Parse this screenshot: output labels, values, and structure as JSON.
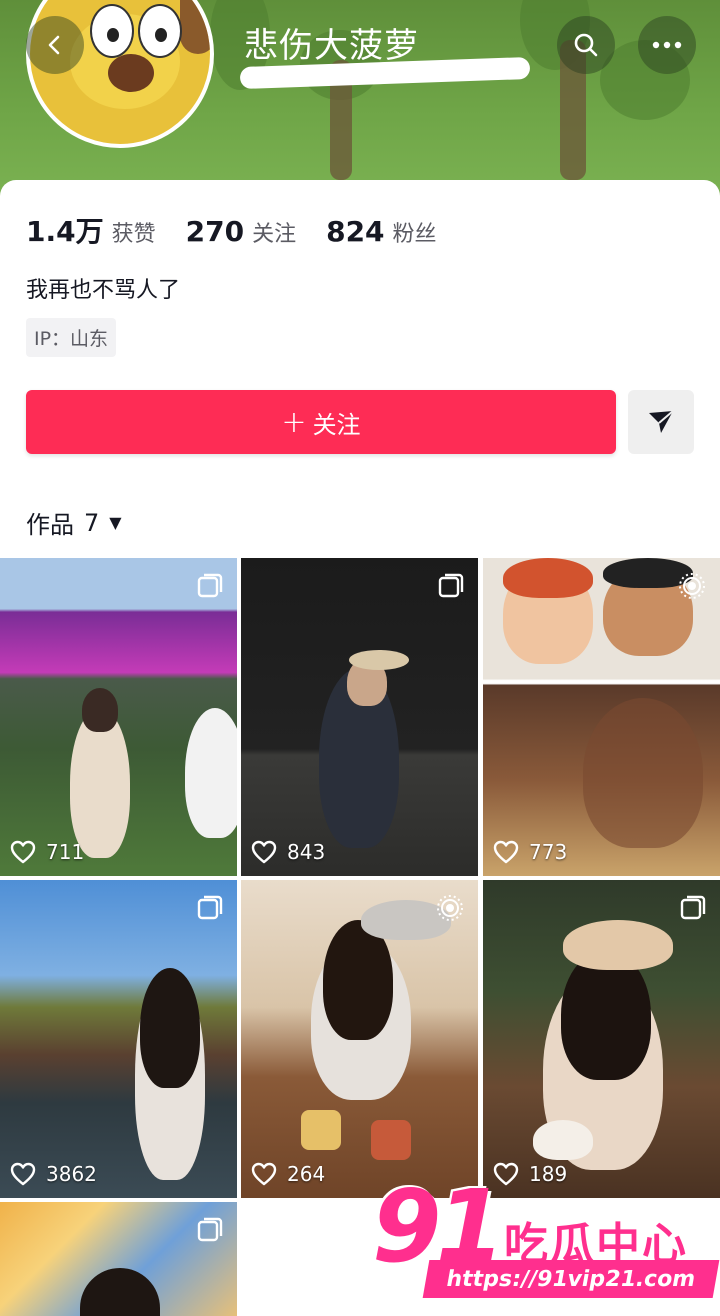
{
  "profile": {
    "nickname": "悲伤大菠萝",
    "stats": [
      {
        "num": "1.4万",
        "label": "获赞"
      },
      {
        "num": "270",
        "label": "关注"
      },
      {
        "num": "824",
        "label": "粉丝"
      }
    ],
    "bio": "我再也不骂人了",
    "ip": "IP：山东"
  },
  "actions": {
    "follow_plus": "+",
    "follow_label": "关注"
  },
  "works": {
    "title": "作品",
    "count": "7",
    "caret": "▼"
  },
  "posts": [
    {
      "likes": "711"
    },
    {
      "likes": "843"
    },
    {
      "likes": "773"
    },
    {
      "likes": "3862"
    },
    {
      "likes": "264"
    },
    {
      "likes": "189"
    },
    {
      "likes": ""
    }
  ],
  "watermark": {
    "number": "91",
    "name": "吃瓜中心",
    "url": "https://91vip21.com"
  },
  "colors": {
    "follow": "#fe2c55",
    "watermark": "#ff2f8e",
    "banner": "#6fa547"
  },
  "icons": [
    "back-icon",
    "search-icon",
    "more-icon",
    "share-icon",
    "heart-icon",
    "multi-image-icon",
    "live-photo-icon"
  ]
}
